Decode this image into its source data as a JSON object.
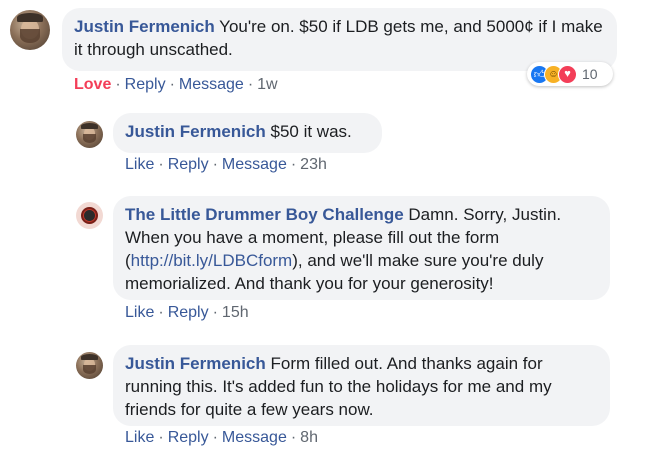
{
  "comments": [
    {
      "author": "Justin Fermenich",
      "text": " You're on. $50 if LDB gets me, and 5000¢ if I make it through unscathed.",
      "reaction_label": "Love",
      "actions": [
        "Reply",
        "Message"
      ],
      "time": "1w",
      "reactions": {
        "icons": [
          "like-icon",
          "haha-icon",
          "love-icon"
        ],
        "count": "10"
      }
    },
    {
      "author": "Justin Fermenich",
      "text": " $50 it was.",
      "actions": [
        "Like",
        "Reply",
        "Message"
      ],
      "time": "23h"
    },
    {
      "author": "The Little Drummer Boy Challenge",
      "text_before_link": " Damn. Sorry, Justin. When you have a moment, please fill out the form (",
      "link": "http://bit.ly/LDBCform",
      "text_after_link": "), and we'll make sure you're duly memorialized. And thank you for your generosity!",
      "actions": [
        "Like",
        "Reply"
      ],
      "time": "15h"
    },
    {
      "author": "Justin Fermenich",
      "text": " Form filled out. And thanks again for running this. It's added fun to the holidays for me and my friends for quite a few years now.",
      "actions": [
        "Like",
        "Reply",
        "Message"
      ],
      "time": "8h"
    }
  ],
  "colors": {
    "author": "#385898",
    "bubble": "#f2f3f5",
    "love": "#f33e58",
    "meta": "#606770"
  }
}
